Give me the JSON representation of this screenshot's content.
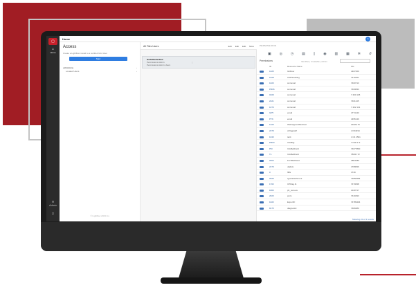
{
  "app": {
    "home_label": "Home",
    "user_initial": "G",
    "rail_home_label": "Home",
    "rail_logo": "▢",
    "rail_bottom_label": "Admin"
  },
  "access": {
    "title": "Access",
    "description": "Create a Lightflow model to a certified Grid User",
    "button_label": "Start",
    "tree_root": "•All Admins",
    "tree_child": "Located Users",
    "footer": "© Lightflow 2023 Inc."
  },
  "list": {
    "header": "All Files Users",
    "actions": [
      "Edit",
      "Edit",
      "Edit",
      "More"
    ],
    "selected": {
      "name": "Harfelfauderflow",
      "line1": "Permissions Admin",
      "line2": "Permissions Admin Users"
    }
  },
  "permissions": {
    "header": "PERMISSIONS",
    "title": "Permissions",
    "filter": "Identifier | Creatable | Admin",
    "columns": [
      "ID",
      "Resource Name",
      "IDs"
    ],
    "rows": [
      {
        "code": "1025",
        "name": "GitFlow",
        "val": "4407460"
      },
      {
        "code": "1028",
        "name": "CAPS/editing",
        "val": "7410451"
      },
      {
        "code": "1023",
        "name": "sm/email",
        "val": "7400713"
      },
      {
        "code": "PR06",
        "name": "sm/email",
        "val": "7400843"
      },
      {
        "code": "0109",
        "name": "sm/email",
        "val": "7 400 145"
      },
      {
        "code": "2421",
        "name": "sm/email",
        "val": "7401145"
      },
      {
        "code": "1070",
        "name": "sm/email",
        "val": "7 402 131"
      },
      {
        "code": "GP5",
        "name": "email",
        "val": "4774143"
      },
      {
        "code": "PYK",
        "name": "email",
        "val": "4495140"
      },
      {
        "code": "1320",
        "name": "Web/appendfiles/text",
        "val": "4022E 76"
      },
      {
        "code": "2279",
        "name": "c/Flagstaff",
        "val": "4 F64034"
      },
      {
        "code": "1043",
        "name": "tacit",
        "val": "4 C4 2501"
      },
      {
        "code": "PR03",
        "name": "InfoBag",
        "val": "7 F4D F 3"
      },
      {
        "code": "PM",
        "name": "InfoBeltField",
        "val": "74077800"
      },
      {
        "code": "T1",
        "name": "InfoBeltField",
        "val": "7800F 72"
      },
      {
        "code": "2004",
        "name": "FinTBeltField",
        "val": "4B64480"
      },
      {
        "code": "2479",
        "name": "ubjlists",
        "val": "4708846"
      },
      {
        "code": "0",
        "name": "filfls",
        "val": "4749"
      },
      {
        "code": "2025",
        "name": "type/attachment",
        "val": "74858484"
      },
      {
        "code": "1702",
        "name": "CPFlag.tb",
        "val": "7470848"
      },
      {
        "code": "1863",
        "name": "ph_remove",
        "val": "4040717"
      },
      {
        "code": "2023",
        "name": "pmls",
        "val": "7440493"
      },
      {
        "code": "1022",
        "name": "Export/F",
        "val": "74789404"
      },
      {
        "code": "8175",
        "name": "diagnostic",
        "val": "7480480"
      }
    ],
    "more_link": "Showing 24 of 1 results"
  }
}
